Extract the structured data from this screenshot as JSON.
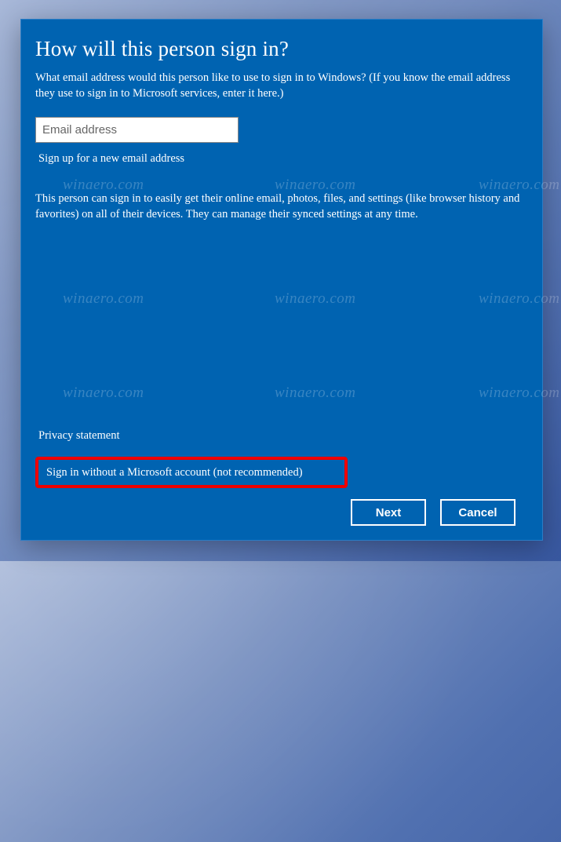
{
  "dialog": {
    "title": "How will this person sign in?",
    "subtitle": "What email address would this person like to use to sign in to Windows? (If you know the email address they use to sign in to Microsoft services, enter it here.)",
    "email_placeholder": "Email address",
    "signup_link": "Sign up for a new email address",
    "description": "This person can sign in to easily get their online email, photos, files, and settings (like browser history and favorites) on all of their devices. They can manage their synced settings at any time.",
    "privacy_link": "Privacy statement",
    "no_ms_account_link": "Sign in without a Microsoft account (not recommended)",
    "next_button": "Next",
    "cancel_button": "Cancel"
  },
  "watermark_text": "winaero.com"
}
